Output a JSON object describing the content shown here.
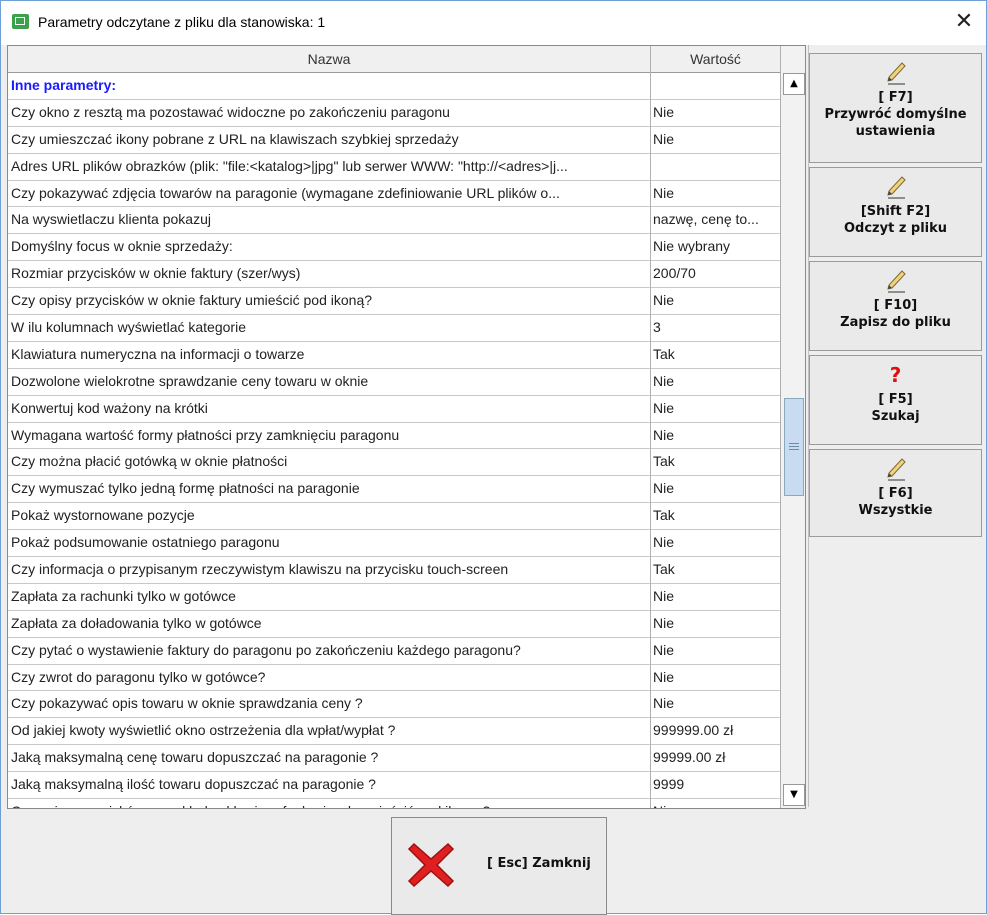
{
  "window": {
    "title": "Parametry odczytane z pliku dla stanowiska: 1",
    "close_symbol": "✕"
  },
  "table": {
    "columns": [
      "Nazwa",
      "Wartość"
    ],
    "rows": [
      {
        "name": "Inne parametry:",
        "value": "",
        "section": true
      },
      {
        "name": "Czy okno z resztą ma pozostawać widoczne po zakończeniu paragonu",
        "value": "Nie"
      },
      {
        "name": "Czy umieszczać ikony pobrane z URL na klawiszach szybkiej sprzedaży",
        "value": "Nie"
      },
      {
        "name": "Adres URL plików obrazków (plik: \"file:<katalog>|jpg\" lub serwer WWW: \"http://<adres>|j...",
        "value": ""
      },
      {
        "name": "Czy pokazywać zdjęcia towarów na paragonie (wymagane zdefiniowanie URL plików o...",
        "value": "Nie"
      },
      {
        "name": "Na wyswietlaczu klienta pokazuj",
        "value": "nazwę, cenę to..."
      },
      {
        "name": "Domyślny focus w oknie sprzedaży:",
        "value": "Nie wybrany"
      },
      {
        "name": "Rozmiar przycisków w oknie faktury (szer/wys)",
        "value": "200/70"
      },
      {
        "name": "Czy opisy przycisków w oknie faktury umieścić pod ikoną?",
        "value": "Nie"
      },
      {
        "name": "W ilu kolumnach wyświetlać kategorie",
        "value": "3"
      },
      {
        "name": "Klawiatura numeryczna na informacji o towarze",
        "value": "Tak"
      },
      {
        "name": "Dozwolone wielokrotne sprawdzanie ceny towaru w oknie",
        "value": "Nie"
      },
      {
        "name": "Konwertuj kod ważony na krótki",
        "value": "Nie"
      },
      {
        "name": "Wymagana wartość formy płatności przy zamknięciu paragonu",
        "value": "Nie"
      },
      {
        "name": "Czy można płacić gotówką w oknie płatności",
        "value": "Tak"
      },
      {
        "name": "Czy wymuszać tylko jedną formę płatności na paragonie",
        "value": "Nie"
      },
      {
        "name": "Pokaż wystornowane pozycje",
        "value": "Tak"
      },
      {
        "name": "Pokaż podsumowanie ostatniego paragonu",
        "value": "Nie"
      },
      {
        "name": "Czy informacja o przypisanym rzeczywistym klawiszu na przycisku touch-screen",
        "value": "Tak"
      },
      {
        "name": "Zapłata za rachunki tylko w gotówce",
        "value": "Nie"
      },
      {
        "name": "Zapłata za doładowania tylko w gotówce",
        "value": "Nie"
      },
      {
        "name": "Czy pytać o wystawienie faktury do paragonu po zakończeniu każdego paragonu?",
        "value": "Nie"
      },
      {
        "name": "Czy zwrot do paragonu tylko w gotówce?",
        "value": "Nie"
      },
      {
        "name": "Czy pokazywać opis towaru w oknie sprawdzania ceny ?",
        "value": "Nie"
      },
      {
        "name": "Od jakiej kwoty wyświetlić okno ostrzeżenia dla wpłat/wypłat ?",
        "value": "999999.00 zł"
      },
      {
        "name": "Jaką maksymalną cenę towaru dopuszczać na paragonie ?",
        "value": "99999.00 zł"
      },
      {
        "name": "Jaką maksymalną ilość towaru dopuszczać na paragonie ?",
        "value": "9999"
      },
      {
        "name": "Czy opisy przycisków na zakładce klawiszy funkcyjnych umieścić pod ikoną ?",
        "value": "Nie"
      }
    ]
  },
  "scrollbar": {
    "position_fraction": 0.5,
    "up_arrow": "▲",
    "down_arrow": "▼"
  },
  "side_buttons": [
    {
      "key": "[ F7]",
      "label": "Przywróć domyślne ustawienia",
      "icon": "pencil-icon"
    },
    {
      "key": "[Shift F2]",
      "label": "Odczyt z pliku",
      "icon": "pencil-icon"
    },
    {
      "key": "[ F10]",
      "label": "Zapisz do pliku",
      "icon": "pencil-icon"
    },
    {
      "key": "[ F5]",
      "label": "Szukaj",
      "icon": "question-icon",
      "symbol": "?"
    },
    {
      "key": "[ F6]",
      "label": "Wszystkie",
      "icon": "pencil-icon"
    }
  ],
  "close_button": {
    "label": "[ Esc] Zamknij",
    "icon": "red-x-icon"
  },
  "colors": {
    "section_header": "#1a1aff",
    "titlebar_border": "#6f9fd8",
    "question_mark": "#e01010",
    "close_x": "#e02020"
  }
}
